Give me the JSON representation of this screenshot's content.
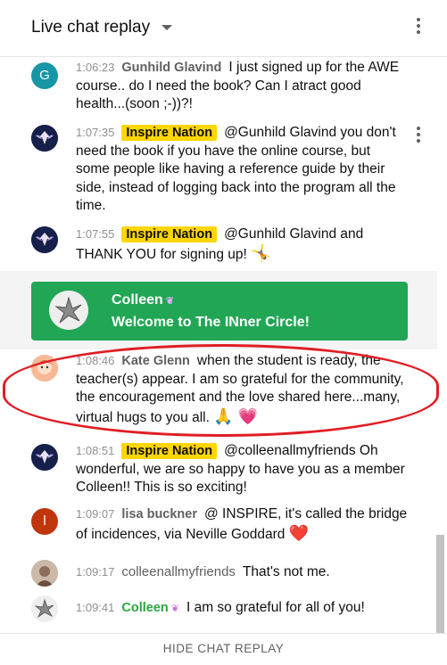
{
  "header": {
    "title": "Live chat replay"
  },
  "messages": [
    {
      "time": "1:06:23",
      "author": "Gunhild Glavind",
      "text": "I just signed up for the AWE course.. do I need the book? Can I atract good health...(soon ;-))?!",
      "avatar_letter": "G",
      "avatar_color": "#1797a6"
    },
    {
      "time": "1:07:35",
      "author": "Inspire Nation",
      "text": "@Gunhild Glavind you don't need the book if you have the online course, but some people like having a reference guide by their side, instead of logging back into the program all the time."
    },
    {
      "time": "1:07:55",
      "author": "Inspire Nation",
      "text": "@Gunhild Glavind and THANK YOU for signing up!",
      "emoji": "🤸"
    },
    {
      "time": "1:08:46",
      "author": "Kate Glenn",
      "text": "when the student is ready, the teacher(s) appear. I am so grateful for the community, the encouragement and the love shared here...many, virtual hugs to you all.",
      "emoji": "🙏 💗"
    },
    {
      "time": "1:08:51",
      "author": "Inspire Nation",
      "text": "@colleenallmyfriends Oh wonderful, we are so happy to have you as a member Colleen!! This is so exciting!"
    },
    {
      "time": "1:09:07",
      "author": "lisa buckner",
      "text": "@ INSPIRE, it's called the bridge of incidences, via Neville Goddard",
      "emoji": "❤️",
      "avatar_letter": "l",
      "avatar_color": "#c0360c"
    },
    {
      "time": "1:09:17",
      "author": "colleenallmyfriends",
      "text": "That's not me."
    },
    {
      "time": "1:09:41",
      "author": "Colleen",
      "text": "I am so grateful for all of you!"
    }
  ],
  "banner": {
    "name": "Colleen",
    "text": "Welcome to The INner Circle!",
    "color": "#21a655"
  },
  "footer": {
    "label": "HIDE CHAT REPLAY"
  },
  "colors": {
    "owner_badge": "#ffd600",
    "member_name": "#2ba640",
    "highlight": "#e01e24"
  }
}
